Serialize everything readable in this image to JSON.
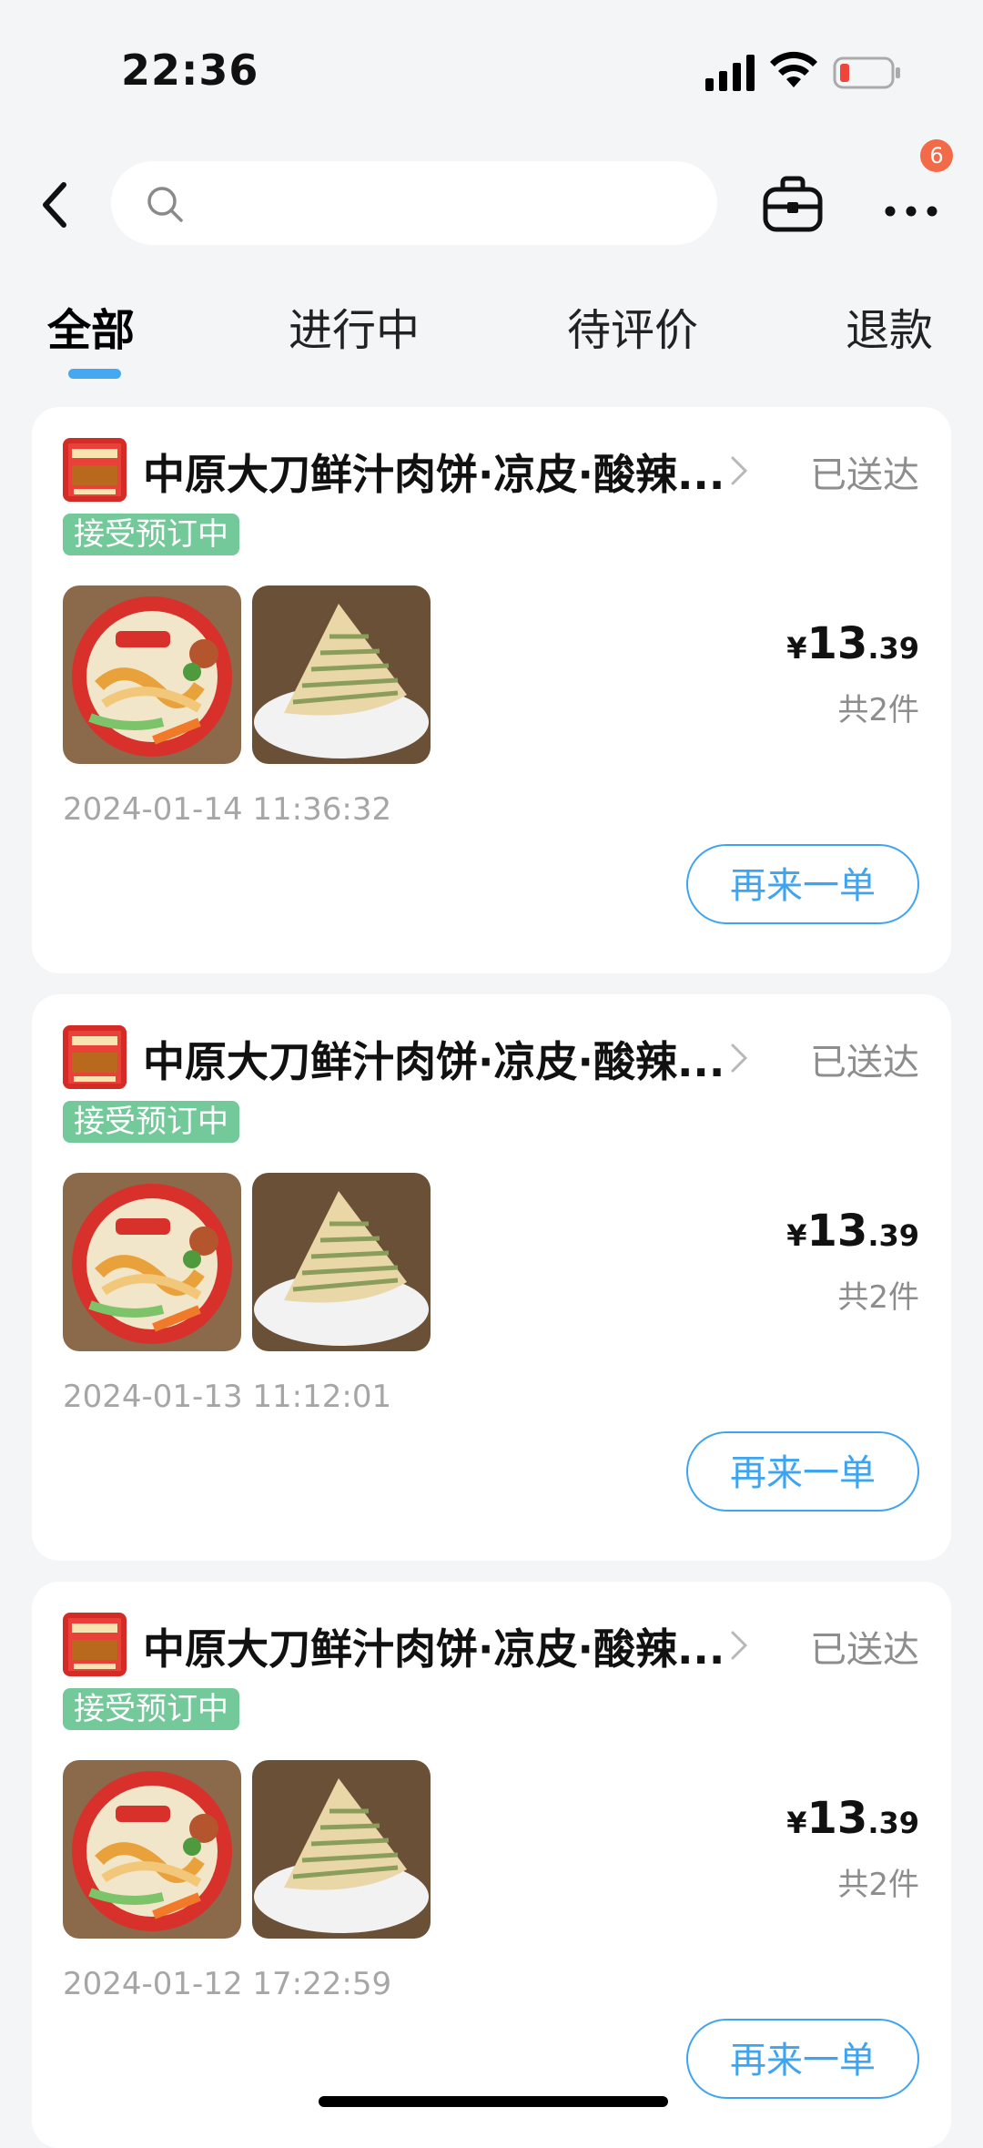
{
  "status_bar": {
    "time": "22:36"
  },
  "header": {
    "search_placeholder": "",
    "notification_count": "6"
  },
  "tabs": [
    {
      "label": "全部"
    },
    {
      "label": "进行中"
    },
    {
      "label": "待评价"
    },
    {
      "label": "退款"
    }
  ],
  "orders": [
    {
      "shop": "中原大刀鲜汁肉饼·凉皮·酸辣...",
      "status": "已送达",
      "tag": "接受预订中",
      "price_symbol": "¥",
      "price_int": "13",
      "price_dec": ".39",
      "count": "共2件",
      "time": "2024-01-14 11:36:32",
      "action": "再来一单"
    },
    {
      "shop": "中原大刀鲜汁肉饼·凉皮·酸辣...",
      "status": "已送达",
      "tag": "接受预订中",
      "price_symbol": "¥",
      "price_int": "13",
      "price_dec": ".39",
      "count": "共2件",
      "time": "2024-01-13 11:12:01",
      "action": "再来一单"
    },
    {
      "shop": "中原大刀鲜汁肉饼·凉皮·酸辣...",
      "status": "已送达",
      "tag": "接受预订中",
      "price_symbol": "¥",
      "price_int": "13",
      "price_dec": ".39",
      "count": "共2件",
      "time": "2024-01-12 17:22:59",
      "action": "再来一单"
    }
  ],
  "colors": {
    "accent": "#3fa4f0",
    "tag_green": "#73c99a",
    "badge": "#f26a48",
    "background": "#f4f5f7"
  }
}
